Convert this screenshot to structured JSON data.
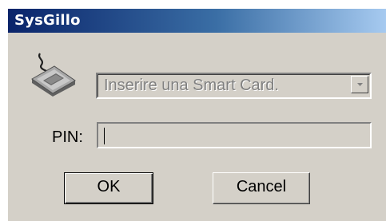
{
  "window": {
    "title": "SysGillo"
  },
  "reader": {
    "icon": "smart-card-reader-icon",
    "selected_value": "Inserire una Smart Card."
  },
  "pin": {
    "label": "PIN:",
    "value": ""
  },
  "buttons": {
    "ok_label": "OK",
    "cancel_label": "Cancel"
  },
  "colors": {
    "dialog_background": "#d4d0c8",
    "titlebar_start": "#0a246a",
    "titlebar_end": "#a6caf0",
    "title_text": "#ffffff",
    "disabled_text": "#808080"
  }
}
